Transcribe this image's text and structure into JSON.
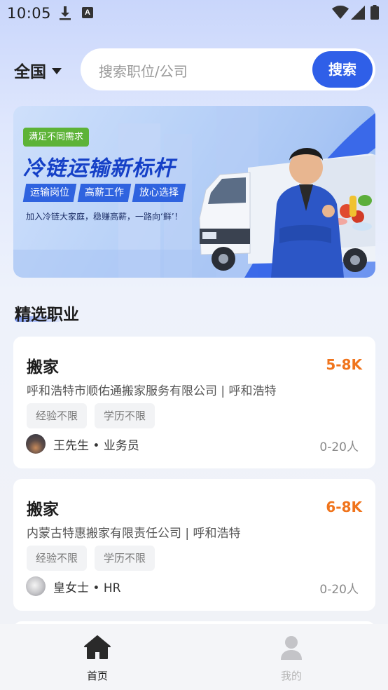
{
  "status_bar": {
    "time": "10:05",
    "a_badge": "A"
  },
  "search": {
    "region": "全国",
    "placeholder": "搜索职位/公司",
    "button": "搜索"
  },
  "banner": {
    "tag": "满足不同需求",
    "title": "冷链运输新标杆",
    "chips": [
      "运输岗位",
      "高薪工作",
      "放心选择"
    ],
    "subtitle": "加入冷链大家庭，稳赚高薪，一路向‘鲜’！"
  },
  "section": {
    "title": "精选职业"
  },
  "jobs": [
    {
      "title": "搬家",
      "salary": "5-8K",
      "company": "呼和浩特市顺佑通搬家服务有限公司 | 呼和浩特",
      "tags": [
        "经验不限",
        "学历不限"
      ],
      "recruiter": "王先生 • 业务员",
      "company_scale": "0-20人"
    },
    {
      "title": "搬家",
      "salary": "6-8K",
      "company": "内蒙古特惠搬家有限责任公司 | 呼和浩特",
      "tags": [
        "经验不限",
        "学历不限"
      ],
      "recruiter": "皇女士 • HR",
      "company_scale": "0-20人"
    }
  ],
  "bottom_nav": {
    "items": [
      {
        "label": "首页",
        "icon": "home-icon",
        "active": true
      },
      {
        "label": "我的",
        "icon": "user-icon",
        "active": false
      }
    ]
  },
  "colors": {
    "accent": "#2f5fe8",
    "salary": "#f0741c",
    "tag_green": "#5db337"
  }
}
